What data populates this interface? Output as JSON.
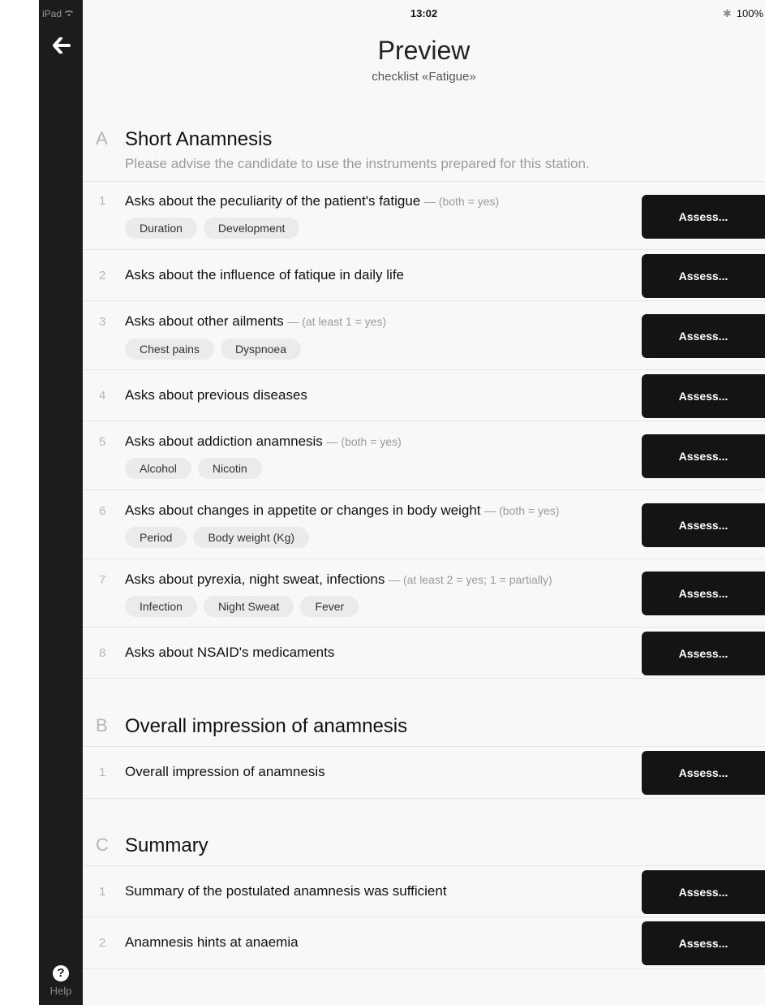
{
  "status": {
    "device": "iPad",
    "time": "13:02",
    "battery": "100%"
  },
  "header": {
    "title": "Preview",
    "subtitle": "checklist «Fatigue»"
  },
  "sidebar": {
    "help_label": "Help"
  },
  "assess_label": "Assess...",
  "sections": [
    {
      "letter": "A",
      "title": "Short Anamnesis",
      "description": "Please advise the candidate to use the instruments prepared for this station.",
      "items": [
        {
          "num": "1",
          "text": "Asks about the peculiarity of the patient's fatigue",
          "hint": "— (both = yes)",
          "tags": [
            "Duration",
            "Development"
          ]
        },
        {
          "num": "2",
          "text": "Asks about the influence of fatique in daily life",
          "hint": "",
          "tags": []
        },
        {
          "num": "3",
          "text": "Asks about other ailments",
          "hint": "— (at least 1 = yes)",
          "tags": [
            "Chest pains",
            "Dyspnoea"
          ]
        },
        {
          "num": "4",
          "text": "Asks about previous diseases",
          "hint": "",
          "tags": []
        },
        {
          "num": "5",
          "text": "Asks about addiction anamnesis",
          "hint": "— (both = yes)",
          "tags": [
            "Alcohol",
            "Nicotin"
          ]
        },
        {
          "num": "6",
          "text": "Asks about changes in appetite or changes in body weight",
          "hint": "— (both = yes)",
          "tags": [
            "Period",
            "Body weight (Kg)"
          ]
        },
        {
          "num": "7",
          "text": "Asks about pyrexia, night sweat, infections",
          "hint": "— (at least 2 = yes; 1 = partially)",
          "tags": [
            "Infection",
            "Night Sweat",
            "Fever"
          ]
        },
        {
          "num": "8",
          "text": "Asks about NSAID's medicaments",
          "hint": "",
          "tags": []
        }
      ]
    },
    {
      "letter": "B",
      "title": "Overall impression of anamnesis",
      "description": "",
      "items": [
        {
          "num": "1",
          "text": "Overall impression of anamnesis",
          "hint": "",
          "tags": []
        }
      ]
    },
    {
      "letter": "C",
      "title": "Summary",
      "description": "",
      "items": [
        {
          "num": "1",
          "text": "Summary of the postulated anamnesis was sufficient",
          "hint": "",
          "tags": []
        },
        {
          "num": "2",
          "text": "Anamnesis hints at anaemia",
          "hint": "",
          "tags": []
        }
      ]
    }
  ]
}
